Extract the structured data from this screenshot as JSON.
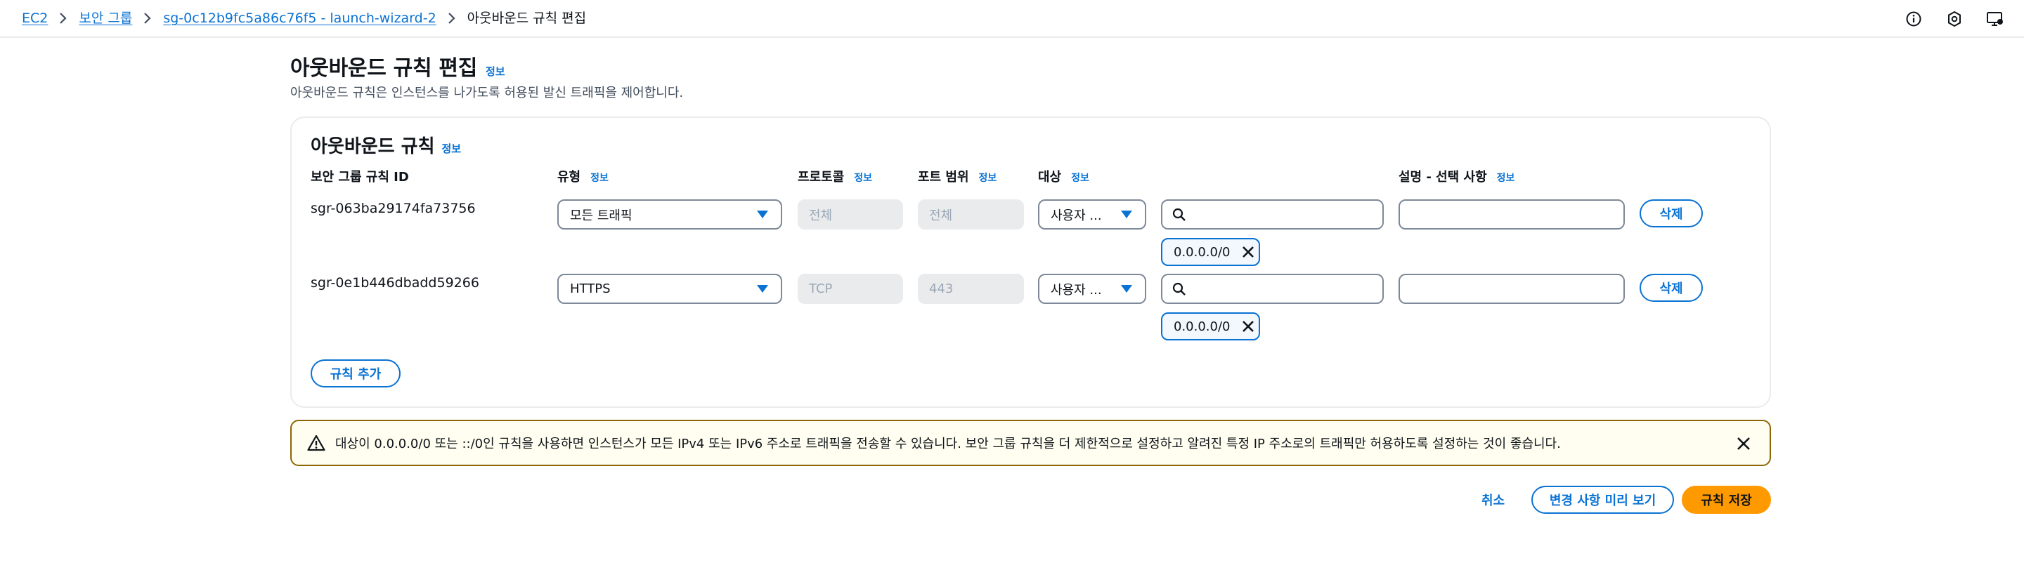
{
  "breadcrumb": {
    "items": [
      "EC2",
      "보안 그룹",
      "sg-0c12b9fc5a86c76f5 - launch-wizard-2"
    ],
    "current": "아웃바운드 규칙 편집"
  },
  "header": {
    "title": "아웃바운드 규칙 편집",
    "info": "정보",
    "description": "아웃바운드 규칙은 인스턴스를 나가도록 허용된 발신 트래픽을 제어합니다."
  },
  "rules_panel": {
    "title": "아웃바운드 규칙",
    "info": "정보",
    "columns": {
      "rule_id": "보안 그룹 규칙 ID",
      "type": "유형",
      "protocol": "프로토콜",
      "port_range": "포트 범위",
      "destination": "대상",
      "description": "설명 - 선택 사항",
      "info": "정보"
    },
    "rows": [
      {
        "rule_id": "sgr-063ba29174fa73756",
        "type": "모든 트래픽",
        "protocol": "전체",
        "port_range": "전체",
        "destination_type": "사용자 ...",
        "cidr_token": "0.0.0.0/0",
        "delete_label": "삭제"
      },
      {
        "rule_id": "sgr-0e1b446dbadd59266",
        "type": "HTTPS",
        "protocol": "TCP",
        "port_range": "443",
        "destination_type": "사용자 ...",
        "cidr_token": "0.0.0.0/0",
        "delete_label": "삭제"
      }
    ],
    "add_rule_label": "규칙 추가"
  },
  "alert": {
    "text": "대상이 0.0.0.0/0 또는 ::/0인 규칙을 사용하면 인스턴스가 모든 IPv4 또는 IPv6 주소로 트래픽을 전송할 수 있습니다. 보안 그룹 규칙을 더 제한적으로 설정하고 알려진 특정 IP 주소로의 트래픽만 허용하도록 설정하는 것이 좋습니다."
  },
  "footer": {
    "cancel": "취소",
    "preview": "변경 사항 미리 보기",
    "save": "규칙 저장"
  },
  "colors": {
    "link": "#0972d3",
    "primary_button": "#ff9900",
    "alert_border": "#8d6605",
    "alert_bg": "#fffef0"
  }
}
